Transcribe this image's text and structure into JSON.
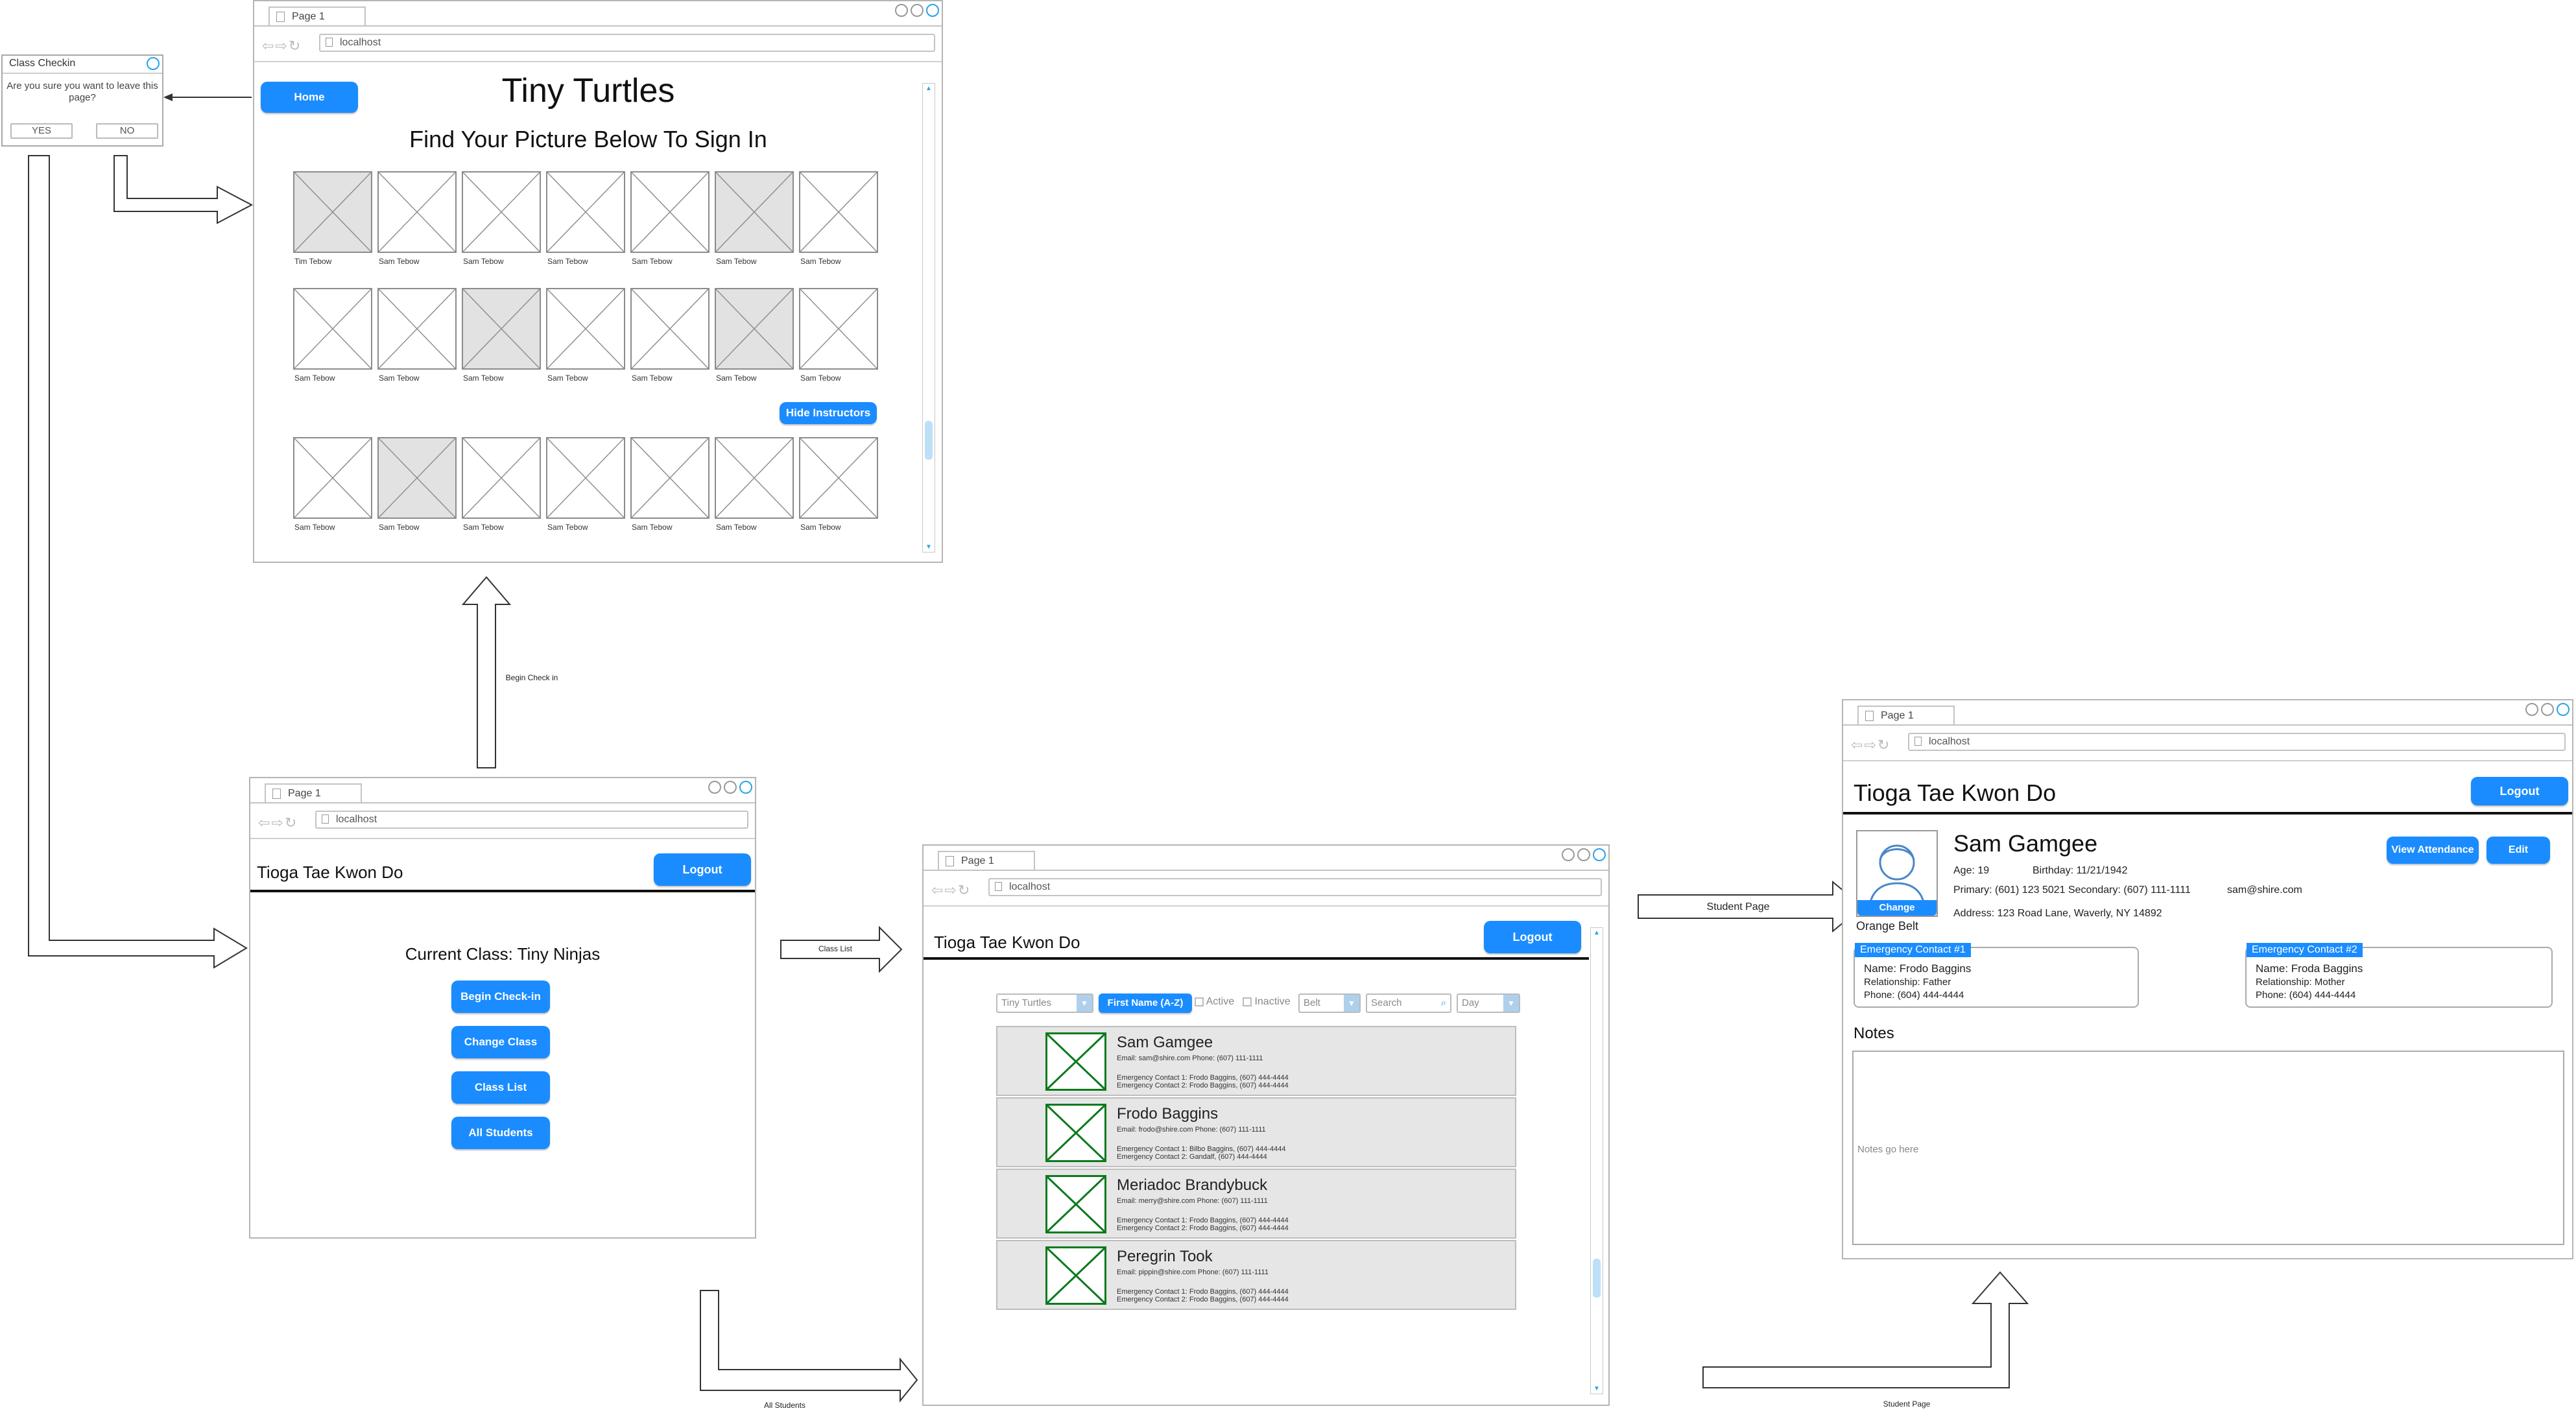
{
  "dialog": {
    "title": "Class Checkin",
    "message": "Are you sure you want to leave this page?",
    "yes_label": "YES",
    "no_label": "NO"
  },
  "checkin_window": {
    "tab_label": "Page 1",
    "url": "localhost",
    "home_label": "Home",
    "title": "Tiny  Turtles",
    "subtitle": "Find Your Picture Below To Sign In",
    "hide_instructors_label": "Hide Instructors",
    "rows": [
      {
        "names": [
          "Tim Tebow",
          "Sam Tebow",
          "Sam Tebow",
          "Sam Tebow",
          "Sam Tebow",
          "Sam Tebow",
          "Sam Tebow"
        ],
        "grey": [
          true,
          false,
          false,
          false,
          false,
          true,
          false
        ]
      },
      {
        "names": [
          "Sam Tebow",
          "Sam Tebow",
          "Sam Tebow",
          "Sam Tebow",
          "Sam Tebow",
          "Sam Tebow",
          "Sam Tebow"
        ],
        "grey": [
          false,
          false,
          true,
          false,
          false,
          true,
          false
        ]
      },
      {
        "names": [
          "Sam Tebow",
          "Sam Tebow",
          "Sam Tebow",
          "Sam Tebow",
          "Sam Tebow",
          "Sam Tebow",
          "Sam Tebow"
        ],
        "grey": [
          false,
          true,
          false,
          false,
          false,
          false,
          false
        ]
      }
    ]
  },
  "home_window": {
    "tab_label": "Page 1",
    "url": "localhost",
    "brand": "Tioga Tae Kwon Do",
    "logout_label": "Logout",
    "current_class": "Current Class: Tiny Ninjas",
    "buttons": [
      "Begin Check-in",
      "Change Class",
      "Class List",
      "All Students"
    ]
  },
  "list_window": {
    "tab_label": "Page 1",
    "url": "localhost",
    "brand": "Tioga Tae Kwon Do",
    "logout_label": "Logout",
    "filters": {
      "class_select": "Tiny Turtles",
      "sort_label": "First Name (A-Z)",
      "active_label": "Active",
      "inactive_label": "Inactive",
      "belt_select": "Belt",
      "search_placeholder": "Search",
      "day_select": "Day"
    },
    "students": [
      {
        "name": "Sam Gamgee",
        "contact": "Email: sam@shire.com Phone: (607) 111-1111",
        "ec1": "Emergency Contact 1: Frodo Baggins, (607) 444-4444",
        "ec2": "Emergency Contact 2: Frodo Baggins, (607) 444-4444"
      },
      {
        "name": "Frodo Baggins",
        "contact": "Email: frodo@shire.com Phone: (607) 111-1111",
        "ec1": "Emergency Contact 1: Bilbo Baggins, (607) 444-4444",
        "ec2": "Emergency Contact 2: Gandalf, (607) 444-4444"
      },
      {
        "name": "Meriadoc Brandybuck",
        "contact": "Email: merry@shire.com Phone: (607) 111-1111",
        "ec1": "Emergency Contact 1: Frodo Baggins, (607) 444-4444",
        "ec2": "Emergency Contact 2: Frodo Baggins, (607) 444-4444"
      },
      {
        "name": "Peregrin Took",
        "contact": "Email: pippin@shire.com Phone: (607) 111-1111",
        "ec1": "Emergency Contact 1: Frodo Baggins, (607) 444-4444",
        "ec2": "Emergency Contact 2: Frodo Baggins, (607) 444-4444"
      }
    ]
  },
  "student_window": {
    "tab_label": "Page 1",
    "url": "localhost",
    "brand": "Tioga Tae Kwon Do",
    "logout_label": "Logout",
    "name": "Sam Gamgee",
    "age": "Age: 19",
    "birthday": "Birthday: 11/21/1942",
    "phones": "Primary: (601) 123 5021 Secondary: (607) 111-1111",
    "email": "sam@shire.com",
    "address": "Address: 123 Road Lane, Waverly, NY 14892",
    "change_label": "Change",
    "belt": "Orange Belt",
    "view_attendance_label": "View Attendance",
    "edit_label": "Edit",
    "ec1": {
      "label": "Emergency Contact #1",
      "name": "Name: Frodo Baggins",
      "relationship": "Relationship: Father",
      "phone": "Phone: (604) 444-4444"
    },
    "ec2": {
      "label": "Emergency Contact #2",
      "name": "Name: Froda Baggins",
      "relationship": "Relationship: Mother",
      "phone": "Phone: (604) 444-4444"
    },
    "notes_heading": "Notes",
    "notes_placeholder": "Notes go here"
  },
  "flow_labels": {
    "begin_check_in": "Begin Check in",
    "class_list": "Class List",
    "all_students": "All Students",
    "student_page_top": "Student Page",
    "student_page_bottom": "Student Page"
  }
}
